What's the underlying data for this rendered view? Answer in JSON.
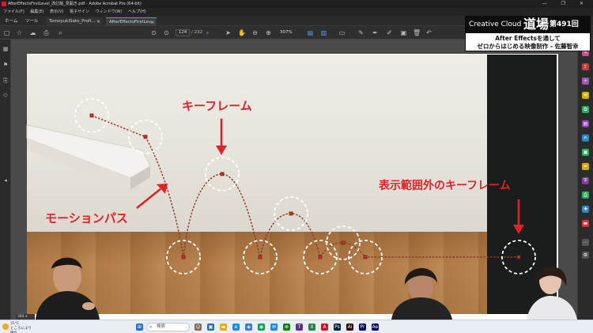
{
  "window": {
    "title": "AfterEffectsFirstLevel_改訂版_見開き.pdf - Adobe Acrobat Pro (64-bit)",
    "controls": "— ❐ ✕"
  },
  "menu": [
    "ファイル(F)",
    "編集(E)",
    "表示(V)",
    "電子サイン",
    "ウィンドウ(W)",
    "ヘルプ(H)"
  ],
  "tabs": {
    "home": "ホーム",
    "tools": "ツール",
    "file1": "TomoyukiSato_Profi...",
    "file2": "AfterEffectsFirstLev..."
  },
  "toolbar": {
    "page_current": "124",
    "page_total": "/ 232",
    "zoom": "307%"
  },
  "annotations": {
    "keyframe": "キーフレーム",
    "motion_path": "モーションパス",
    "out_of_range": "表示範囲外のキーフレーム"
  },
  "broadcast": {
    "brand": "Creative Cloud",
    "dojo": "道場",
    "episode": "第491回",
    "line1": "After Effectsを通して",
    "line2": "ゼロからはじめる映像制作 - 佐藤智幸"
  },
  "statusbar": {
    "size": "384 x"
  },
  "taskbar": {
    "weather_temp": "31°C",
    "weather_desc": "ところにより晴れ",
    "search_placeholder": "検索"
  },
  "colors": {
    "annotation_red": "#e0222a",
    "path_brown": "#8a3b2a",
    "acrobat_blue": "#5a9af0"
  }
}
